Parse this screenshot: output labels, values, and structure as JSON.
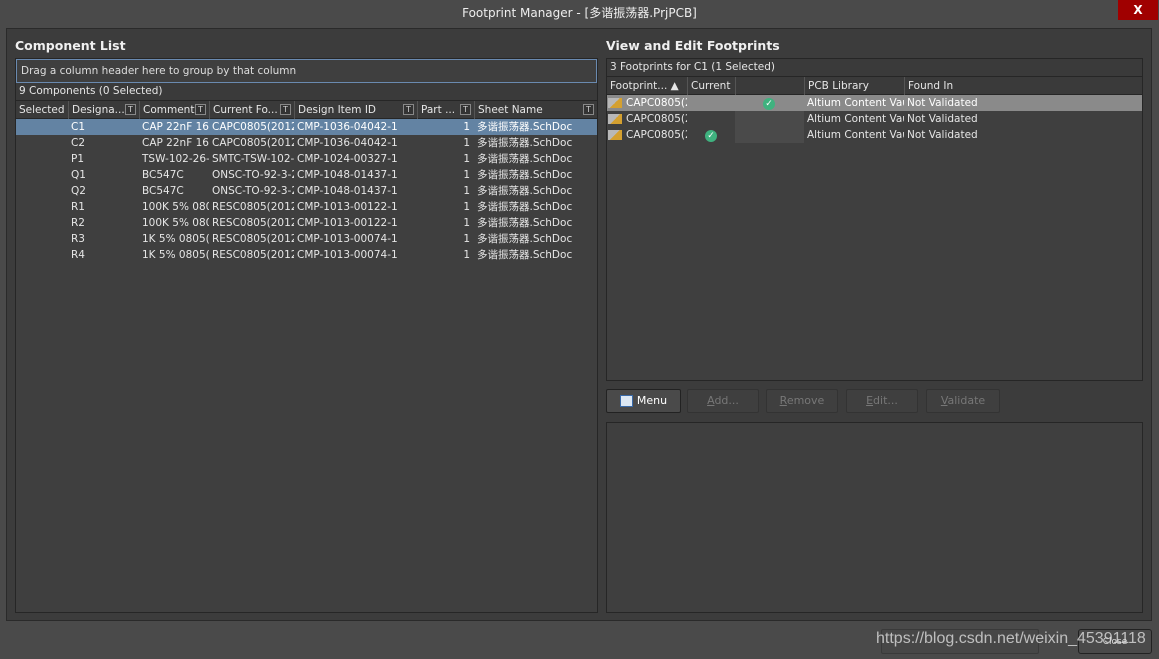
{
  "window": {
    "title": "Footprint Manager - [多谐振荡器.PrjPCB]",
    "close": "X"
  },
  "left": {
    "title": "Component List",
    "group_hint": "Drag a column header here to group by that column",
    "count": "9 Components (0 Selected)",
    "columns": [
      "Selected",
      "Designa...",
      "Comment",
      "Current Fo...",
      "Design Item ID",
      "Part ...",
      "Sheet Name"
    ],
    "rows": [
      [
        "",
        "C1",
        "CAP 22nF 16\\",
        "CAPC0805(2012)",
        "CMP-1036-04042-1",
        "1",
        "多谐振荡器.SchDoc"
      ],
      [
        "",
        "C2",
        "CAP 22nF 16\\",
        "CAPC0805(2012)",
        "CMP-1036-04042-1",
        "1",
        "多谐振荡器.SchDoc"
      ],
      [
        "",
        "P1",
        "TSW-102-26-(",
        "SMTC-TSW-102-2",
        "CMP-1024-00327-1",
        "1",
        "多谐振荡器.SchDoc"
      ],
      [
        "",
        "Q1",
        "BC547C",
        "ONSC-TO-92-3-2",
        "CMP-1048-01437-1",
        "1",
        "多谐振荡器.SchDoc"
      ],
      [
        "",
        "Q2",
        "BC547C",
        "ONSC-TO-92-3-2",
        "CMP-1048-01437-1",
        "1",
        "多谐振荡器.SchDoc"
      ],
      [
        "",
        "R1",
        "100K 5% 0805",
        "RESC0805(2012)_",
        "CMP-1013-00122-1",
        "1",
        "多谐振荡器.SchDoc"
      ],
      [
        "",
        "R2",
        "100K 5% 0805",
        "RESC0805(2012)_",
        "CMP-1013-00122-1",
        "1",
        "多谐振荡器.SchDoc"
      ],
      [
        "",
        "R3",
        "1K 5% 0805(2",
        "RESC0805(2012)_",
        "CMP-1013-00074-1",
        "1",
        "多谐振荡器.SchDoc"
      ],
      [
        "",
        "R4",
        "1K 5% 0805(2",
        "RESC0805(2012)_",
        "CMP-1013-00074-1",
        "1",
        "多谐振荡器.SchDoc"
      ]
    ],
    "selected_row": 0
  },
  "right": {
    "title": "View and Edit Footprints",
    "count": "3 Footprints for C1 (1 Selected)",
    "columns": [
      "Footprint... ▲",
      "Current",
      "",
      "PCB Library",
      "Found In"
    ],
    "rows": [
      {
        "footprint": "CAPC0805(20",
        "current": false,
        "in_col3": true,
        "library": "Altium Content Vau",
        "found": "Not Validated"
      },
      {
        "footprint": "CAPC0805(20",
        "current": false,
        "in_col3": false,
        "library": "Altium Content Vau",
        "found": "Not Validated"
      },
      {
        "footprint": "CAPC0805(20",
        "current": true,
        "in_col3": false,
        "library": "Altium Content Vau",
        "found": "Not Validated"
      }
    ],
    "selected_row": 0,
    "buttons": {
      "menu": "Menu",
      "add": "Add...",
      "remove": "Remove",
      "edit": "Edit...",
      "validate": "Validate"
    }
  },
  "footer": {
    "close": "Close",
    "watermark": "https://blog.csdn.net/weixin_45391118"
  }
}
